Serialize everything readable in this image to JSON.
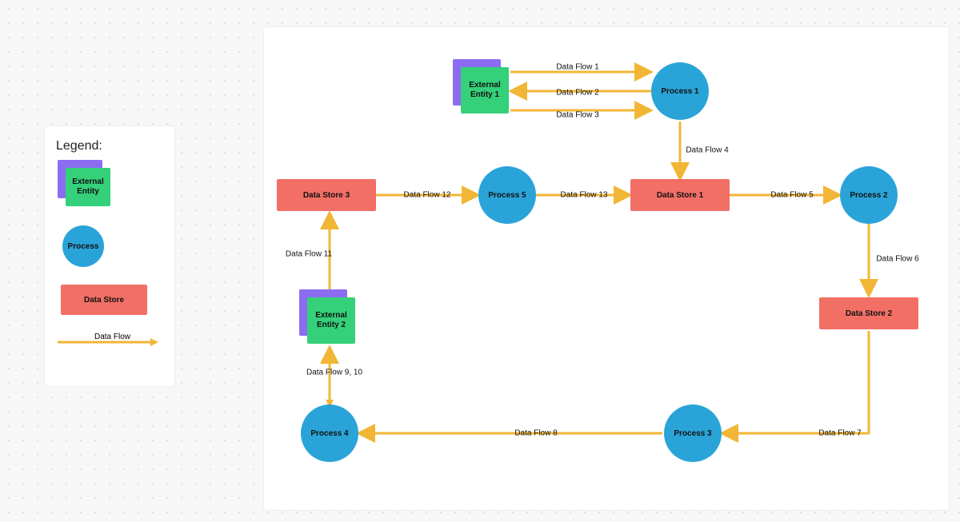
{
  "legend": {
    "title": "Legend:",
    "entity_label": "External Entity",
    "process_label": "Process",
    "datastore_label": "Data Store",
    "flow_label": "Data Flow"
  },
  "nodes": {
    "entity1": {
      "label": "External Entity 1"
    },
    "entity2": {
      "label": "External Entity 2"
    },
    "process1": {
      "label": "Process 1"
    },
    "process2": {
      "label": "Process 2"
    },
    "process3": {
      "label": "Process 3"
    },
    "process4": {
      "label": "Process 4"
    },
    "process5": {
      "label": "Process 5"
    },
    "store1": {
      "label": "Data Store 1"
    },
    "store2": {
      "label": "Data Store 2"
    },
    "store3": {
      "label": "Data Store 3"
    }
  },
  "flows": {
    "f1": "Data Flow 1",
    "f2": "Data Flow 2",
    "f3": "Data Flow 3",
    "f4": "Data Flow 4",
    "f5": "Data Flow 5",
    "f6": "Data Flow 6",
    "f7": "Data Flow 7",
    "f8": "Data Flow 8",
    "f910": "Data Flow 9, 10",
    "f11": "Data Flow 11",
    "f12": "Data Flow 12",
    "f13": "Data Flow 13"
  }
}
